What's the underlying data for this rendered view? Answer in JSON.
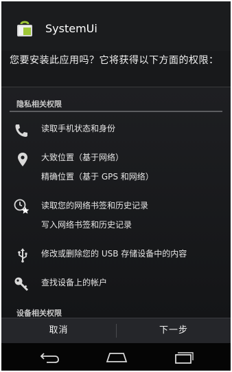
{
  "app": {
    "title": "SystemUi",
    "icon": "android-app-icon"
  },
  "prompt": "您要安装此应用吗？它将获得以下方面的权限：",
  "sections": {
    "privacy": {
      "header": "隐私相关权限"
    },
    "device": {
      "header": "设备相关权限"
    }
  },
  "permissions": [
    {
      "icon": "phone-icon",
      "lines": [
        "读取手机状态和身份"
      ]
    },
    {
      "icon": "location-pin-icon",
      "lines": [
        "大致位置（基于网络）",
        "精确位置（基于 GPS 和网络）"
      ]
    },
    {
      "icon": "bookmark-history-icon",
      "lines": [
        "读取您的网络书签和历史记录",
        "写入网络书签和历史记录"
      ]
    },
    {
      "icon": "usb-icon",
      "lines": [
        "修改或删除您的 USB 存储设备中的内容"
      ]
    },
    {
      "icon": "key-icon",
      "lines": [
        "查找设备上的帐户"
      ]
    }
  ],
  "actions": {
    "cancel": "取消",
    "next": "下一步"
  },
  "navigation": {
    "back": "back-icon",
    "home": "home-icon",
    "recents": "recents-icon"
  },
  "colors": {
    "background": "#18191b",
    "text": "#e6e6e6",
    "accent": "#9fc737"
  }
}
